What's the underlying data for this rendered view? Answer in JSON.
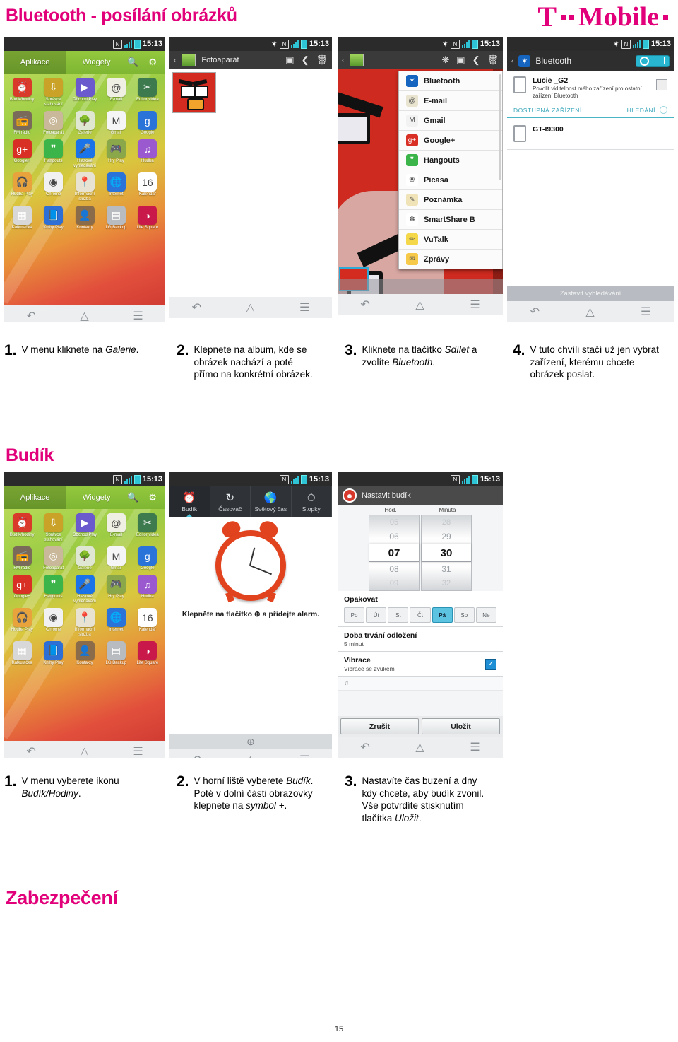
{
  "page": {
    "title_bluetooth": "Bluetooth - posílání obrázků",
    "title_budik": "Budík",
    "title_zabezpeceni": "Zabezpečení",
    "page_number": "15",
    "brand": {
      "letter": "T",
      "word": "Mobile",
      "color": "#e2007a"
    }
  },
  "status_bar": {
    "time": "15:13",
    "nfc": "N",
    "bluetooth": "B"
  },
  "app_drawer": {
    "tab_apps": "Aplikace",
    "tab_widgets": "Widgety",
    "search_icon": "search-icon",
    "settings_icon": "gear-icon",
    "apps": [
      {
        "label": "Budík/hodiny",
        "glyph": "⏰",
        "color": "#d93b2b"
      },
      {
        "label": "Správce stahování",
        "glyph": "⇩",
        "color": "#c9a227"
      },
      {
        "label": "Obchod Play",
        "glyph": "▶",
        "color": "#6a5acd"
      },
      {
        "label": "E-mail",
        "glyph": "@",
        "color": "#efefe4"
      },
      {
        "label": "Editor videa",
        "glyph": "✂",
        "color": "#3d7a4e"
      },
      {
        "label": "FM rádio",
        "glyph": "📻",
        "color": "#7a6a5a"
      },
      {
        "label": "Fotoaparát",
        "glyph": "◎",
        "color": "#c9b89a"
      },
      {
        "label": "Galerie",
        "glyph": "🌳",
        "color": "#dfe6d2"
      },
      {
        "label": "Gmail",
        "glyph": "M",
        "color": "#f5f5f5"
      },
      {
        "label": "Google",
        "glyph": "g",
        "color": "#2a73d9"
      },
      {
        "label": "Google+",
        "glyph": "g+",
        "color": "#d93025"
      },
      {
        "label": "Hangouts",
        "glyph": "❞",
        "color": "#3bb54a"
      },
      {
        "label": "Hlasové vyhledávání",
        "glyph": "🎤",
        "color": "#1a73e8"
      },
      {
        "label": "Hry Play",
        "glyph": "🎮",
        "color": "#8aa84a"
      },
      {
        "label": "Hudba",
        "glyph": "♫",
        "color": "#9b59d0"
      },
      {
        "label": "Hudba Play",
        "glyph": "🎧",
        "color": "#e8a33d"
      },
      {
        "label": "Chrome",
        "glyph": "◉",
        "color": "#f1f1f1"
      },
      {
        "label": "Informační služba",
        "glyph": "📍",
        "color": "#e8e2d2"
      },
      {
        "label": "Internet",
        "glyph": "🌐",
        "color": "#2a73d9"
      },
      {
        "label": "Kalendář",
        "glyph": "16",
        "color": "#ffffff"
      },
      {
        "label": "Kalkulačka",
        "glyph": "▦",
        "color": "#d8d8d8"
      },
      {
        "label": "Knihy Play",
        "glyph": "📘",
        "color": "#2e6fd6"
      },
      {
        "label": "Kontakty",
        "glyph": "👤",
        "color": "#8a6b4a"
      },
      {
        "label": "LG Backup",
        "glyph": "▤",
        "color": "#b8bcc0"
      },
      {
        "label": "Life Square",
        "glyph": "◑",
        "color": "#c9184a"
      }
    ]
  },
  "gallery_screen": {
    "title": "Fotoaparát",
    "back_icon": "chevron-left-icon",
    "thumb_icon": "album-thumbnail",
    "camera_icon": "camera-icon",
    "share_icon": "share-icon",
    "delete_icon": "trash-icon"
  },
  "share_screen": {
    "smartshare_icon": "smartshare-icon",
    "camera_icon": "camera-icon",
    "share_icon": "share-icon",
    "delete_icon": "trash-icon",
    "menu": [
      {
        "label": "Bluetooth",
        "glyph": "✶",
        "color": "#1565c0"
      },
      {
        "label": "E-mail",
        "glyph": "@",
        "color": "#e8e4cf"
      },
      {
        "label": "Gmail",
        "glyph": "M",
        "color": "#f2f2f2"
      },
      {
        "label": "Google+",
        "glyph": "g+",
        "color": "#d93025"
      },
      {
        "label": "Hangouts",
        "glyph": "❞",
        "color": "#3bb54a"
      },
      {
        "label": "Picasa",
        "glyph": "❀",
        "color": "#ffffff"
      },
      {
        "label": "Poznámka",
        "glyph": "✎",
        "color": "#f0e3b8"
      },
      {
        "label": "SmartShare B",
        "glyph": "✽",
        "color": "#ffffff"
      },
      {
        "label": "VuTalk",
        "glyph": "✏",
        "color": "#f5d84a"
      },
      {
        "label": "Zprávy",
        "glyph": "✉",
        "color": "#f7c948"
      }
    ]
  },
  "bluetooth_screen": {
    "title": "Bluetooth",
    "toggle_state": "ON",
    "my_device_name": "Lucie _G2",
    "my_device_sub": "Povolit viditelnost mého zařízení pro ostatní zařízení Bluetooth",
    "section_available": "DOSTUPNÁ ZAŘÍZENÍ",
    "section_search": "HLEDÁNÍ",
    "devices": [
      {
        "name": "GT-I9300"
      }
    ],
    "stop_button": "Zastavit vyhledávání"
  },
  "clock_screen": {
    "tabs": [
      {
        "label": "Budík",
        "icon": "alarm-clock-icon",
        "selected": true
      },
      {
        "label": "Časovač",
        "icon": "timer-icon",
        "selected": false
      },
      {
        "label": "Světový čas",
        "icon": "world-clock-icon",
        "selected": false
      },
      {
        "label": "Stopky",
        "icon": "stopwatch-icon",
        "selected": false
      }
    ],
    "hint": "Klepněte na tlačítko ⊕ a přidejte alarm.",
    "add_icon": "plus-circle-icon"
  },
  "alarm_screen": {
    "title": "Nastavit budík",
    "hour_label": "Hod.",
    "minute_label": "Minuta",
    "hours": [
      "05",
      "06",
      "07",
      "08",
      "09"
    ],
    "minutes": [
      "28",
      "29",
      "30",
      "31",
      "32"
    ],
    "selected_hour": "07",
    "selected_minute": "30",
    "repeat_label": "Opakovat",
    "days": [
      {
        "label": "Po",
        "selected": false
      },
      {
        "label": "Út",
        "selected": false
      },
      {
        "label": "St",
        "selected": false
      },
      {
        "label": "Čt",
        "selected": false
      },
      {
        "label": "Pá",
        "selected": true
      },
      {
        "label": "So",
        "selected": false
      },
      {
        "label": "Ne",
        "selected": false
      }
    ],
    "snooze_label": "Doba trvání odložení",
    "snooze_value": "5 minut",
    "vibrate_label": "Vibrace",
    "vibrate_sub": "Vibrace se zvukem",
    "vibrate_checked": true,
    "cancel_button": "Zrušit",
    "save_button": "Uložit"
  },
  "nav_bar": {
    "back": "back-icon",
    "home": "home-icon",
    "menu": "menu-icon"
  },
  "bluetooth_steps": [
    {
      "num": "1.",
      "pre": "V menu kliknete na ",
      "em": "Galerie",
      "post": "."
    },
    {
      "num": "2.",
      "pre": "Klepnete na album, kde se obrázek nachází a poté přímo na konkrétní obrázek.",
      "em": "",
      "post": ""
    },
    {
      "num": "3.",
      "pre": "Kliknete na tlačítko ",
      "em": "Sdílet",
      "post": " a zvolíte ",
      "em2": "Bluetooth",
      "post2": "."
    },
    {
      "num": "4.",
      "pre": "V tuto chvíli stačí už jen vybrat zařízení, kterému chcete obrázek poslat.",
      "em": "",
      "post": ""
    }
  ],
  "budik_steps": [
    {
      "num": "1.",
      "pre": "V menu vyberete ikonu ",
      "em": "Budík/Hodiny",
      "post": "."
    },
    {
      "num": "2.",
      "pre": "V horní liště vyberete ",
      "em": "Budík",
      "post": ". Poté v dolní části obrazovky klepnete na ",
      "em2": "symbol +",
      "post2": "."
    },
    {
      "num": "3.",
      "pre": "Nastavíte čas buzení a dny kdy chcete, aby budík zvonil. Vše potvrdíte stisknutím tlačítka ",
      "em": "Uložit",
      "post": "."
    }
  ]
}
